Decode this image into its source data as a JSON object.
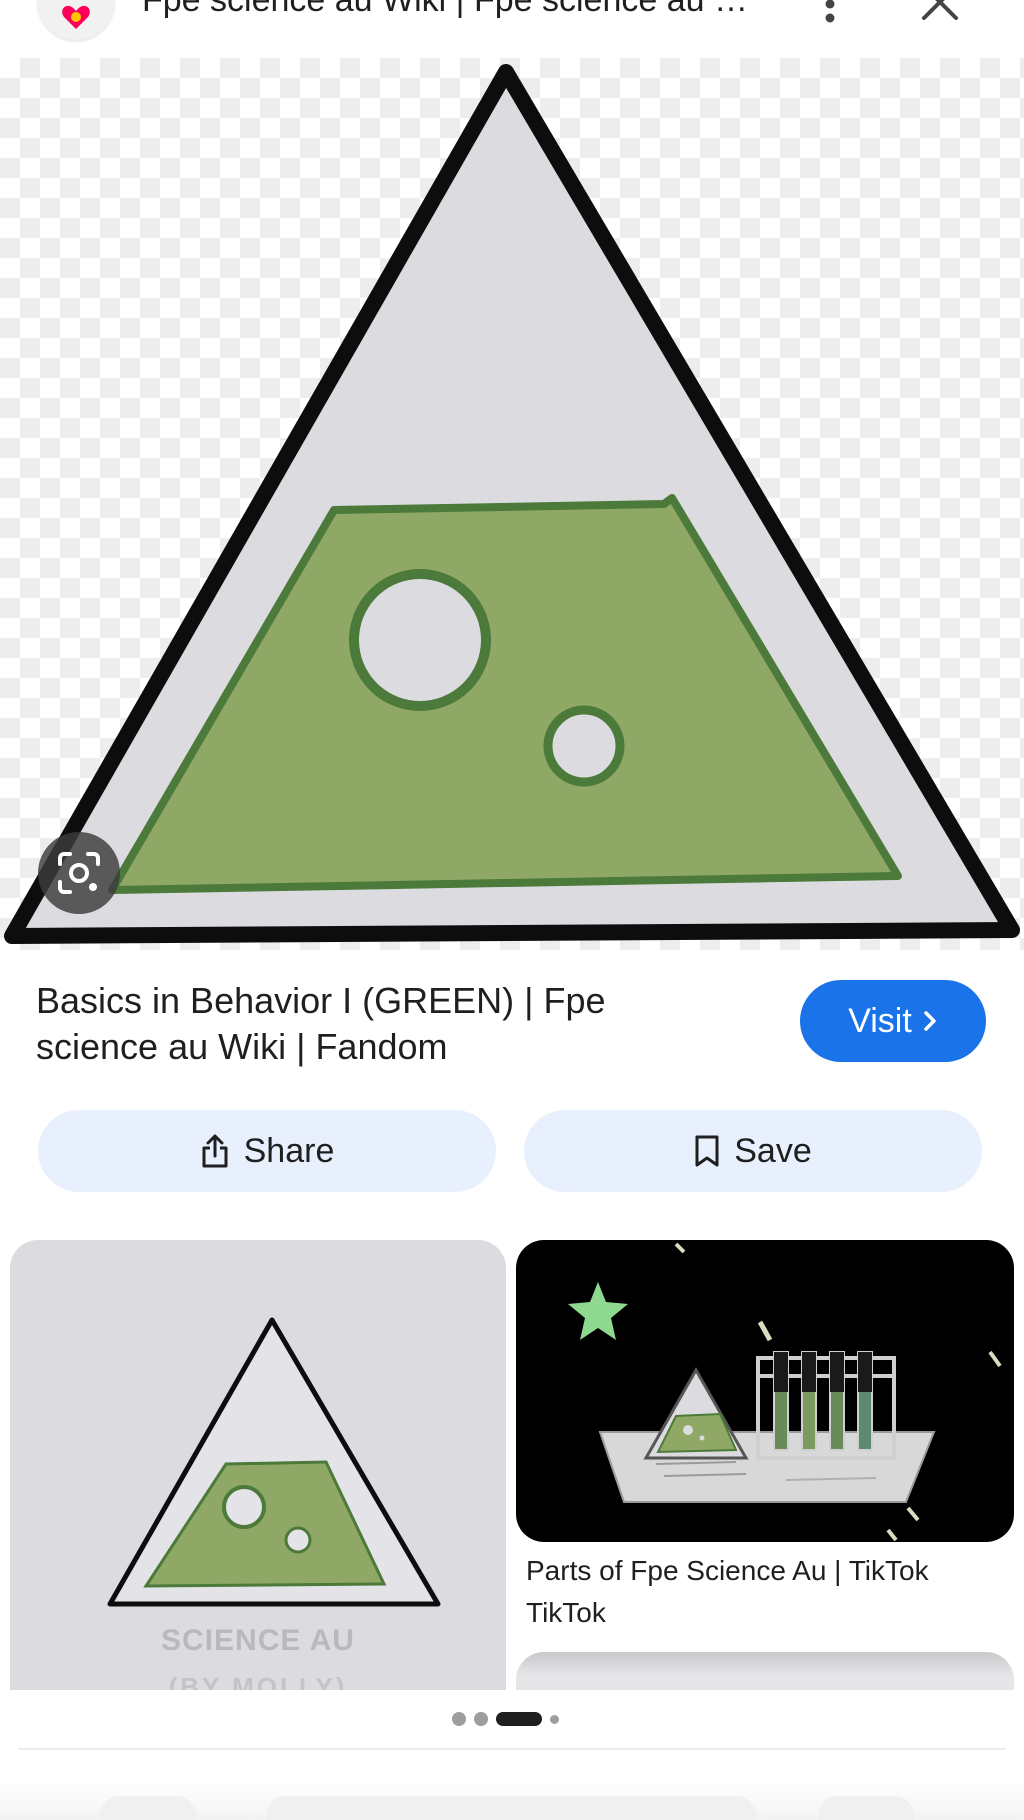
{
  "header": {
    "site_title": "Fpe science au Wiki | Fpe science au W...",
    "favicon_icon": "fandom-heart-icon",
    "more_icon": "more-vert-icon",
    "close_icon": "close-icon"
  },
  "hero": {
    "lens_icon": "google-lens-icon"
  },
  "result": {
    "title": "Basics in Behavior I (GREEN) | Fpe science au Wiki | Fandom",
    "visit_label": "Visit",
    "visit_icon": "chevron-right-icon",
    "share_label": "Share",
    "share_icon": "share-icon",
    "save_label": "Save",
    "save_icon": "bookmark-icon"
  },
  "related": {
    "left_card_text_1": "SCIENCE AU",
    "left_card_text_2": "(BY MOLLY)",
    "right_card_caption": "Parts of Fpe Science Au | TikTok",
    "right_card_source": "TikTok"
  },
  "colors": {
    "accent": "#1a73e8",
    "tonal_button": "#e8f0fe",
    "flask_green": "#8fa865",
    "flask_outline": "#4b7a3a"
  }
}
